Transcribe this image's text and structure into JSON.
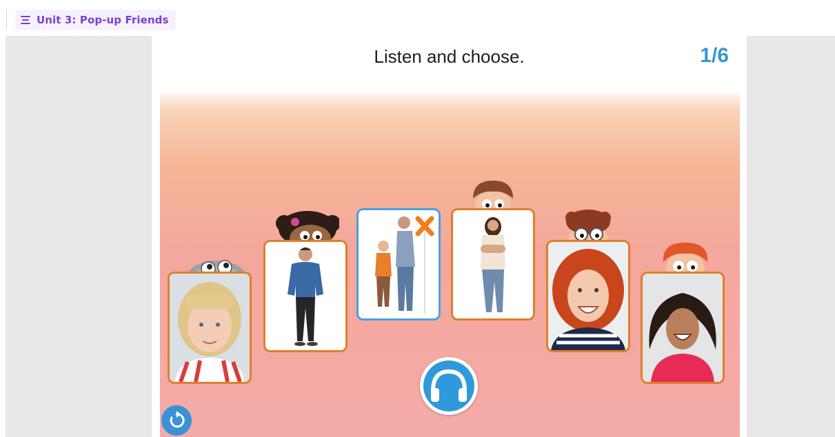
{
  "header": {
    "unit_title": "Unit 3: Pop-up Friends",
    "menu_icon": "menu-icon"
  },
  "activity": {
    "instruction": "Listen and choose.",
    "counter": "1/6",
    "cards": [
      {
        "name": "card-girl-blonde",
        "selected": false
      },
      {
        "name": "card-man-blue-sweater",
        "selected": false
      },
      {
        "name": "card-boy-and-man",
        "selected": true
      },
      {
        "name": "card-woman-crossed-arms",
        "selected": false
      },
      {
        "name": "card-girl-red-hair",
        "selected": false
      },
      {
        "name": "card-girl-laughing",
        "selected": false
      }
    ],
    "audio_icon": "headphones-icon",
    "restart_icon": "restart-icon",
    "mark_icon": "cross-mark-icon"
  },
  "colors": {
    "accent_purple": "#7b3fd0",
    "accent_blue": "#3b95d3",
    "card_border": "#de7f28",
    "card_selected_border": "#4a9fe0"
  }
}
